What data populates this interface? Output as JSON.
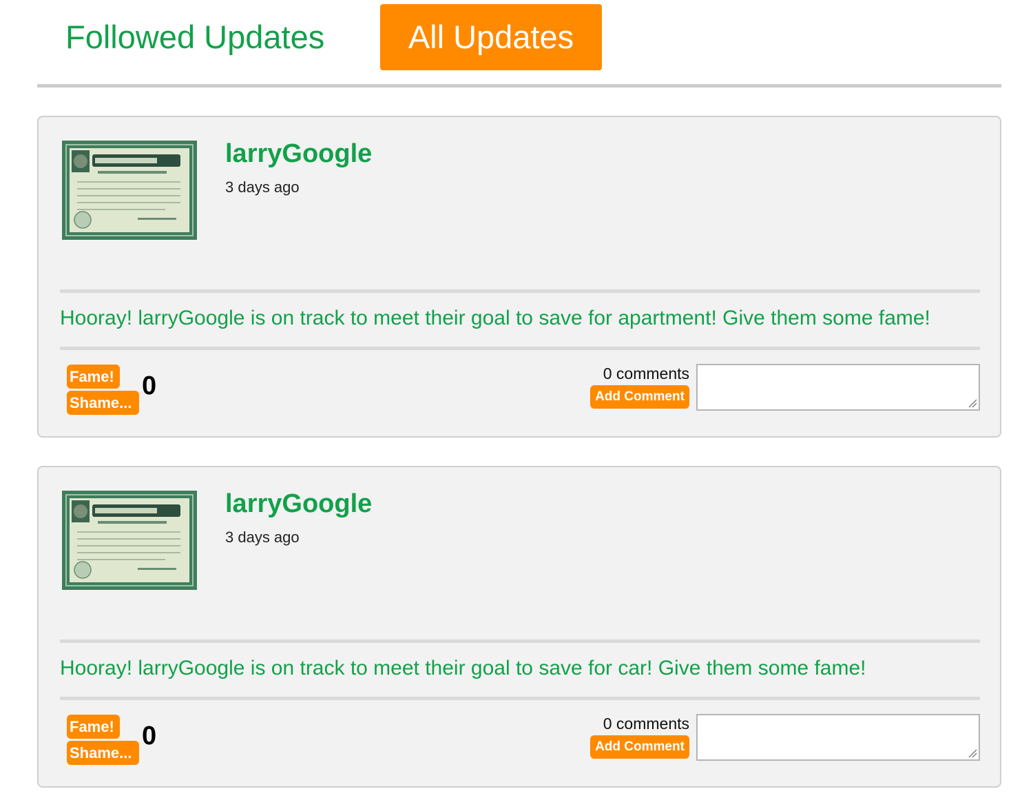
{
  "tabs": {
    "followed_label": "Followed Updates",
    "all_label": "All Updates",
    "active": "All Updates"
  },
  "colors": {
    "accent_orange": "#ff8a00",
    "brand_green": "#12a14a",
    "card_background": "#f2f2f2"
  },
  "updates": [
    {
      "avatar_icon": "stock-certificate-image",
      "username": "larryGoogle",
      "timestamp": "3 days ago",
      "message": "Hooray! larryGoogle is on track to meet their goal to save for apartment! Give them some fame!",
      "fame_label": "Fame!",
      "shame_label": "Shame...",
      "score": "0",
      "comment_count": "0 comments",
      "add_comment_label": "Add Comment",
      "comment_value": ""
    },
    {
      "avatar_icon": "stock-certificate-image",
      "username": "larryGoogle",
      "timestamp": "3 days ago",
      "message": "Hooray! larryGoogle is on track to meet their goal to save for car! Give them some fame!",
      "fame_label": "Fame!",
      "shame_label": "Shame...",
      "score": "0",
      "comment_count": "0 comments",
      "add_comment_label": "Add Comment",
      "comment_value": ""
    }
  ]
}
